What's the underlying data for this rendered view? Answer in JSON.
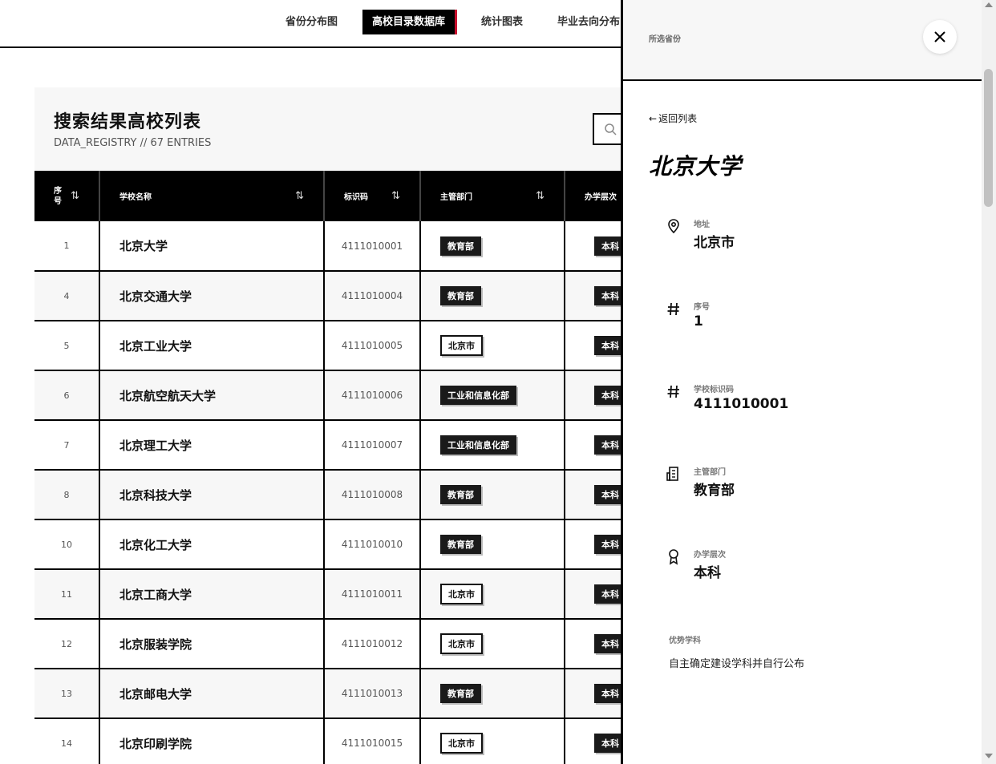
{
  "nav": {
    "tabs": [
      {
        "label": "省份分布图",
        "active": false
      },
      {
        "label": "高校目录数据库",
        "active": true
      },
      {
        "label": "统计图表",
        "active": false
      },
      {
        "label": "毕业去向分布",
        "active": false
      }
    ]
  },
  "main": {
    "title": "搜索结果高校列表",
    "subtitle": "DATA_REGISTRY // 67 ENTRIES",
    "search_icon": "search-icon"
  },
  "table": {
    "columns": [
      "序号",
      "学校名称",
      "标识码",
      "主管部门",
      "办学层次"
    ],
    "sort_icon": "⇅",
    "rows": [
      {
        "seq": "1",
        "name": "北京大学",
        "code": "4111010001",
        "dept": "教育部",
        "dept_style": "solid",
        "level": "本科"
      },
      {
        "seq": "4",
        "name": "北京交通大学",
        "code": "4111010004",
        "dept": "教育部",
        "dept_style": "solid",
        "level": "本科"
      },
      {
        "seq": "5",
        "name": "北京工业大学",
        "code": "4111010005",
        "dept": "北京市",
        "dept_style": "outline",
        "level": "本科"
      },
      {
        "seq": "6",
        "name": "北京航空航天大学",
        "code": "4111010006",
        "dept": "工业和信息化部",
        "dept_style": "solid",
        "level": "本科"
      },
      {
        "seq": "7",
        "name": "北京理工大学",
        "code": "4111010007",
        "dept": "工业和信息化部",
        "dept_style": "solid",
        "level": "本科"
      },
      {
        "seq": "8",
        "name": "北京科技大学",
        "code": "4111010008",
        "dept": "教育部",
        "dept_style": "solid",
        "level": "本科"
      },
      {
        "seq": "10",
        "name": "北京化工大学",
        "code": "4111010010",
        "dept": "教育部",
        "dept_style": "solid",
        "level": "本科"
      },
      {
        "seq": "11",
        "name": "北京工商大学",
        "code": "4111010011",
        "dept": "北京市",
        "dept_style": "outline",
        "level": "本科"
      },
      {
        "seq": "12",
        "name": "北京服装学院",
        "code": "4111010012",
        "dept": "北京市",
        "dept_style": "outline",
        "level": "本科"
      },
      {
        "seq": "13",
        "name": "北京邮电大学",
        "code": "4111010013",
        "dept": "教育部",
        "dept_style": "solid",
        "level": "本科"
      },
      {
        "seq": "14",
        "name": "北京印刷学院",
        "code": "4111010015",
        "dept": "北京市",
        "dept_style": "outline",
        "level": "本科"
      }
    ]
  },
  "drawer": {
    "header_label": "所选省份",
    "close_icon": "close-icon",
    "back_label": "返回列表",
    "back_arrow": "←",
    "title": "北京大学",
    "fields": [
      {
        "icon": "location-pin-icon",
        "label": "地址",
        "value": "北京市"
      },
      {
        "icon": "hash-icon",
        "label": "序号",
        "value": "1"
      },
      {
        "icon": "hash-icon",
        "label": "学校标识码",
        "value": "4111010001"
      },
      {
        "icon": "building-icon",
        "label": "主管部门",
        "value": "教育部"
      },
      {
        "icon": "award-icon",
        "label": "办学层次",
        "value": "本科"
      }
    ],
    "strength_label": "优势学科",
    "strength_value": "自主确定建设学科并自行公布"
  },
  "colors": {
    "accent": "#c8102e",
    "black": "#000000",
    "panel_bg": "#f7f7f7"
  }
}
